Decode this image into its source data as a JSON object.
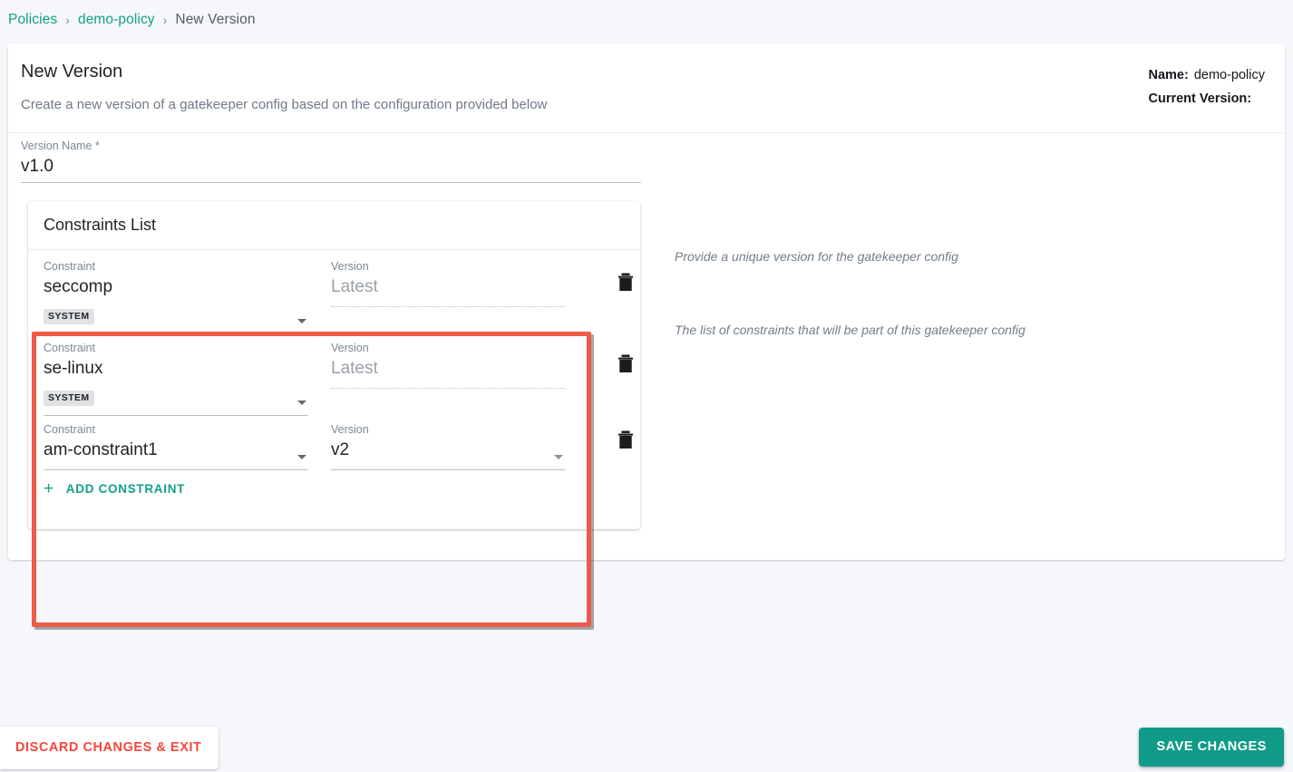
{
  "breadcrumb": {
    "items": [
      {
        "label": "Policies",
        "type": "link"
      },
      {
        "label": "demo-policy",
        "type": "link"
      },
      {
        "label": "New Version",
        "type": "current"
      }
    ],
    "separator": "›"
  },
  "header": {
    "title": "New Version",
    "subtitle": "Create a new version of a gatekeeper config based on the configuration provided below",
    "meta": {
      "name_label": "Name:",
      "name_value": "demo-policy",
      "current_version_label": "Current Version:",
      "current_version_value": ""
    }
  },
  "form": {
    "version_name": {
      "label": "Version Name *",
      "value": "v1.0",
      "hint": "Provide a unique version for the gatekeeper config"
    },
    "constraints": {
      "panel_title": "Constraints List",
      "hint": "The list of constraints that will be part of this gatekeeper config",
      "constraint_label": "Constraint",
      "version_label": "Version",
      "add_button": "ADD CONSTRAINT",
      "add_icon": "plus-icon",
      "delete_icon": "trash-icon",
      "dropdown_icon": "chevron-down-icon",
      "rows": [
        {
          "constraint": "seccomp",
          "badge": "SYSTEM",
          "version": "Latest",
          "version_disabled": true
        },
        {
          "constraint": "se-linux",
          "badge": "SYSTEM",
          "version": "Latest",
          "version_disabled": true
        },
        {
          "constraint": "am-constraint1",
          "badge": "",
          "version": "v2",
          "version_disabled": false
        }
      ]
    }
  },
  "footer": {
    "discard_label": "DISCARD CHANGES & EXIT",
    "save_label": "SAVE CHANGES"
  },
  "colors": {
    "accent_teal": "#13a085",
    "save_button": "#0f9b87",
    "danger_red": "#f4473a",
    "highlight_box": "#ee5b48",
    "page_background": "#f5f7fa"
  }
}
